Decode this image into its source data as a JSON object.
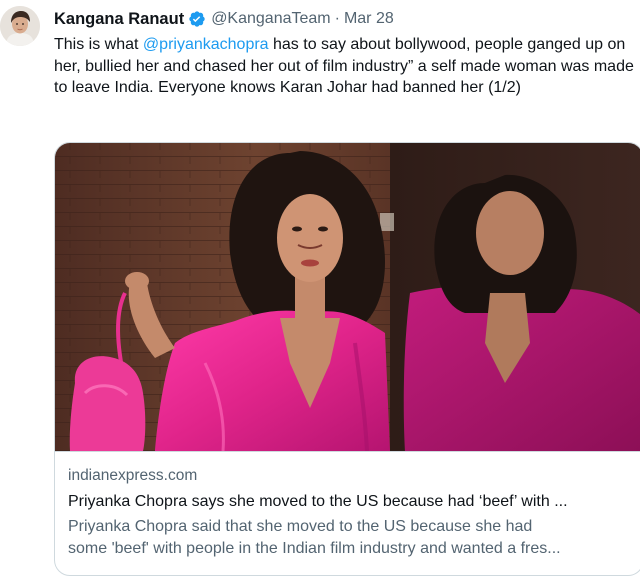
{
  "tweet": {
    "author_name": "Kangana Ranaut",
    "handle": "@KanganaTeam",
    "separator": "·",
    "date": "Mar 28",
    "text_mention": "@priyankachopra",
    "text_before": "This is what ",
    "text_after": " has to say about bollywood, people ganged up on her, bullied her and chased her out of film industry” a self made woman was made to leave India. Everyone knows Karan Johar had banned her (1/2)"
  },
  "card": {
    "domain": "indianexpress.com",
    "title": "Priyanka Chopra says she moved to the US because had ‘beef’ with ...",
    "description_line1": "Priyanka Chopra said that she moved to the US because she had",
    "description_line2": "some 'beef' with people in the Indian film industry and wanted a fres..."
  },
  "colors": {
    "accent": "#1d9bf0",
    "secondary_text": "#536471",
    "border": "#cfd9de",
    "dress_pink": "#e52e8e"
  },
  "icons": {
    "verified": "verified-badge-icon"
  }
}
